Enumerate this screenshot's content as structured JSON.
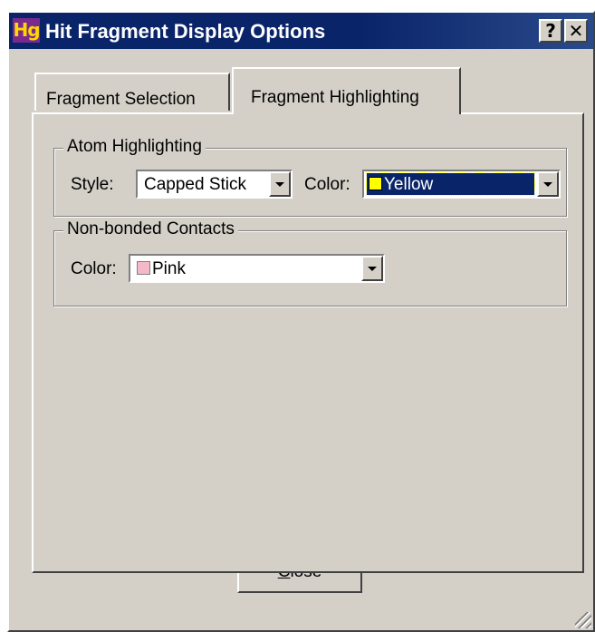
{
  "window": {
    "app_icon_text": "Hg",
    "title": "Hit Fragment Display Options",
    "help_button": "?",
    "close_x_button": "✕"
  },
  "tabs": [
    {
      "label": "Fragment Selection",
      "active": false
    },
    {
      "label": "Fragment Highlighting",
      "active": true
    }
  ],
  "atom_highlighting": {
    "legend": "Atom Highlighting",
    "style_label": "Style:",
    "style_value": "Capped Stick",
    "color_label": "Color:",
    "color_value": "Yellow",
    "color_swatch": "#ffff00"
  },
  "non_bonded_contacts": {
    "legend": "Non-bonded Contacts",
    "color_label": "Color:",
    "color_value": "Pink",
    "color_swatch": "#f4b8c8"
  },
  "footer": {
    "close_accel": "C",
    "close_rest": "lose"
  },
  "colors": {
    "title_bar": "#0a246a",
    "face": "#d4d0c8",
    "selection": "#0a246a"
  }
}
